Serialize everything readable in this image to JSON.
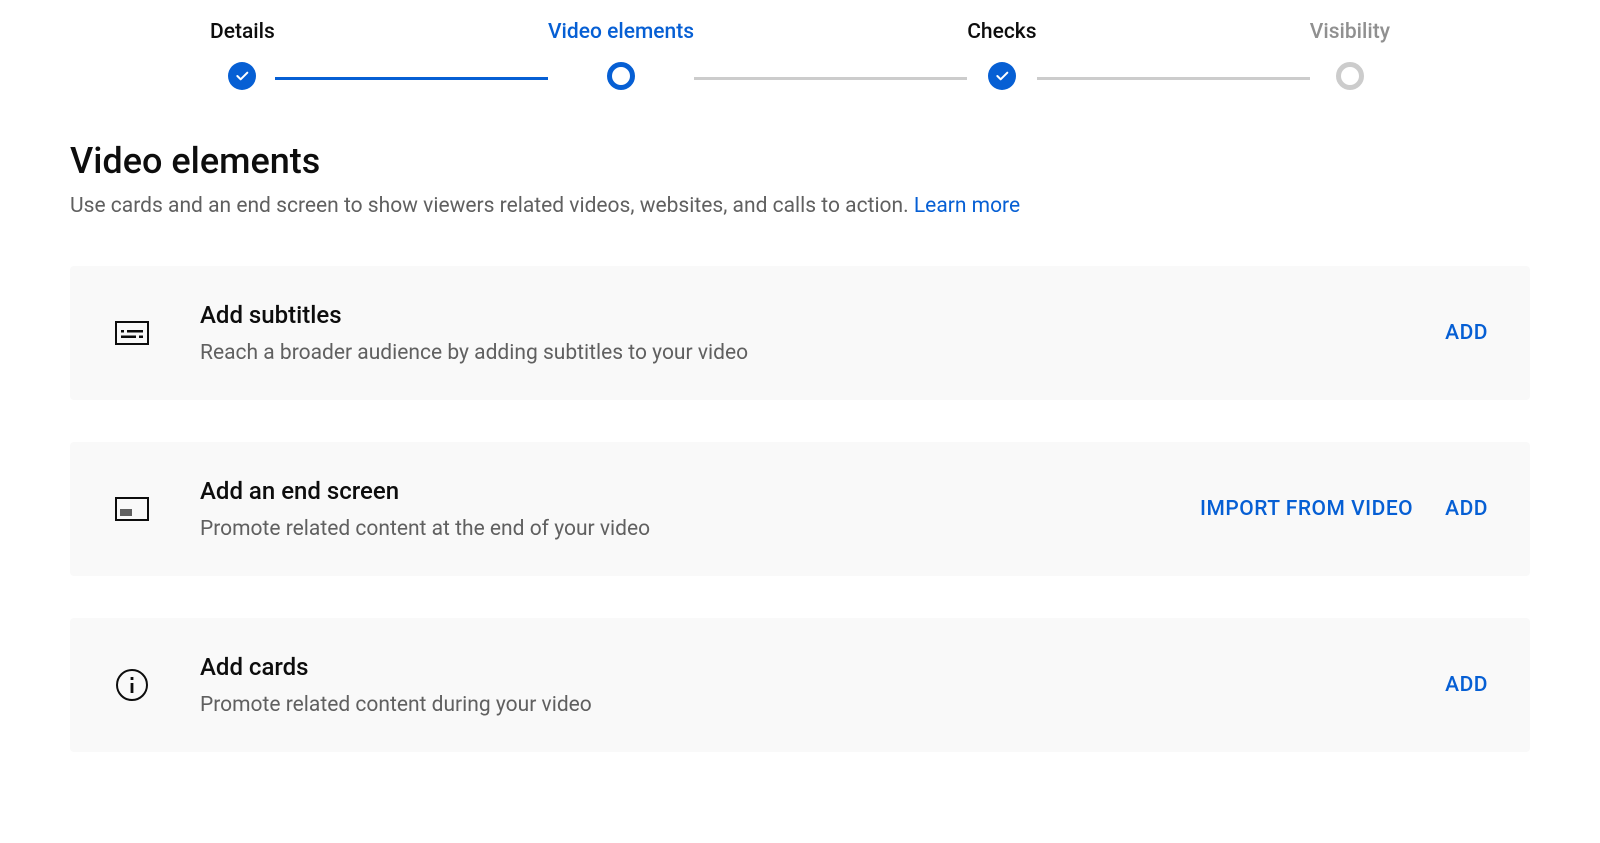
{
  "stepper": {
    "steps": [
      {
        "label": "Details"
      },
      {
        "label": "Video elements"
      },
      {
        "label": "Checks"
      },
      {
        "label": "Visibility"
      }
    ]
  },
  "page": {
    "title": "Video elements",
    "subtitle": "Use cards and an end screen to show viewers related videos, websites, and calls to action. ",
    "learn_more": "Learn more"
  },
  "cards": {
    "subtitles": {
      "title": "Add subtitles",
      "desc": "Reach a broader audience by adding subtitles to your video",
      "add": "ADD"
    },
    "endscreen": {
      "title": "Add an end screen",
      "desc": "Promote related content at the end of your video",
      "import": "IMPORT FROM VIDEO",
      "add": "ADD"
    },
    "addcards": {
      "title": "Add cards",
      "desc": "Promote related content during your video",
      "add": "ADD"
    }
  }
}
